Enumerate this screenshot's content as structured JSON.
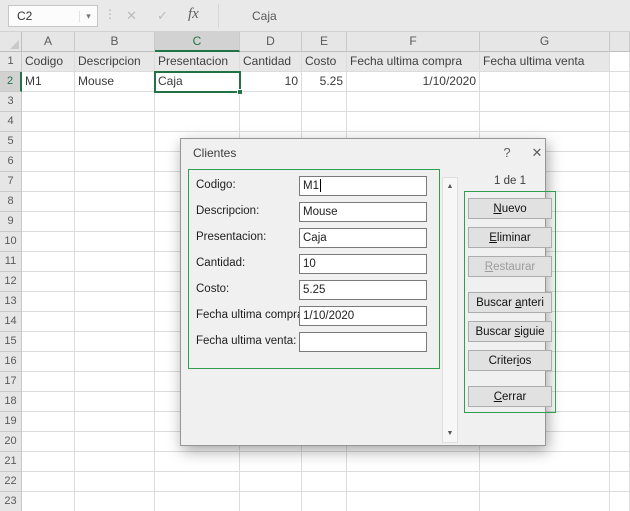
{
  "formula_bar": {
    "name_box_value": "C2",
    "formula_value": "Caja"
  },
  "icons": {
    "name_box_dropdown": "▾",
    "separator_dots": "⋮",
    "cancel": "✕",
    "enter": "✓",
    "function": "fx",
    "dialog_help": "?",
    "dialog_close": "✕",
    "scroll_up": "▲",
    "scroll_down": "▼"
  },
  "grid": {
    "columns": [
      "A",
      "B",
      "C",
      "D",
      "E",
      "F",
      "G"
    ],
    "selected_column": "C",
    "selected_row": 2,
    "row_count": 23,
    "header_row": [
      "Codigo",
      "Descripcion",
      "Presentacion",
      "Cantidad",
      "Costo",
      "Fecha ultima compra",
      "Fecha ultima venta"
    ],
    "data_row": {
      "A": "M1",
      "B": "Mouse",
      "C": "Caja",
      "D": "10",
      "E": "5.25",
      "F": "1/10/2020",
      "G": ""
    }
  },
  "dialog": {
    "title": "Clientes",
    "record_indicator": "1 de 1",
    "focused_field_index": 0,
    "fields": [
      {
        "label": "Codigo:",
        "value": "M1"
      },
      {
        "label": "Descripcion:",
        "value": "Mouse"
      },
      {
        "label": "Presentacion:",
        "value": "Caja"
      },
      {
        "label": "Cantidad:",
        "value": "10"
      },
      {
        "label": "Costo:",
        "value": "5.25"
      },
      {
        "label": "Fecha ultima compra:",
        "value": "1/10/2020"
      },
      {
        "label": "Fecha ultima venta:",
        "value": ""
      }
    ],
    "buttons": [
      {
        "label": "Nuevo",
        "accel_index": 0,
        "enabled": true
      },
      {
        "label": "Eliminar",
        "accel_index": 0,
        "enabled": true
      },
      {
        "label": "Restaurar",
        "accel_index": 0,
        "enabled": false
      },
      {
        "label": "Buscar anteri",
        "accel_index": 7,
        "enabled": true
      },
      {
        "label": "Buscar siguie",
        "accel_index": 7,
        "enabled": true
      },
      {
        "label": "Criterios",
        "accel_index": 6,
        "enabled": true
      },
      {
        "label": "Cerrar",
        "accel_index": 0,
        "enabled": true
      }
    ]
  },
  "colors": {
    "excel_green": "#217346",
    "highlight_green": "#2F9E4F",
    "header_bg": "#E6E6E6",
    "dialog_bg": "#F0F0F0"
  }
}
